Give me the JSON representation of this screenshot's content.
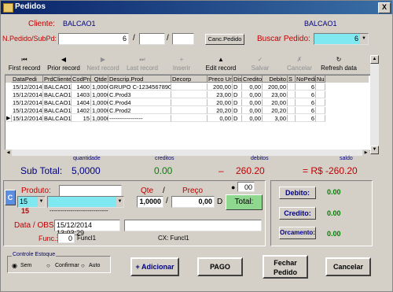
{
  "window": {
    "title": "Pedidos",
    "close_glyph": "X"
  },
  "header": {
    "cliente_label": "Cliente:",
    "cliente_value": "BALCAO1",
    "cliente_right": "BALCAO1",
    "pedido_label": "N.Pedido/SubPd:",
    "pedido_num": "6",
    "slash1": "/",
    "slash2": "/",
    "canc_btn": "Canc.Pedido",
    "buscar_label": "Buscar Pedido:",
    "buscar_value": "6"
  },
  "navbar": [
    {
      "label": "First record",
      "icon": "⏮",
      "disabled": false
    },
    {
      "label": "Prior record",
      "icon": "◀",
      "disabled": false
    },
    {
      "label": "Next record",
      "icon": "▶",
      "disabled": true
    },
    {
      "label": "Last record",
      "icon": "⏭",
      "disabled": true
    },
    {
      "label": "Inserir",
      "icon": "+",
      "disabled": true
    },
    {
      "label": "Edit record",
      "icon": "▲",
      "disabled": false
    },
    {
      "label": "Salvar",
      "icon": "✓",
      "disabled": true
    },
    {
      "label": "Cancelar",
      "icon": "✗",
      "disabled": true
    },
    {
      "label": "Refresh data",
      "icon": "↻",
      "disabled": false
    }
  ],
  "grid": {
    "columns": [
      "DataPedi",
      "PrdCliente",
      "CodProd",
      "Qtde",
      "Descrip.Prod",
      "Decorp",
      "Preco Unit",
      "Dis",
      "Credito",
      "Debito",
      "S",
      "NoPedido",
      "Nu"
    ],
    "rows": [
      [
        "15/12/2014",
        "BALCAO1",
        "1400",
        "1,0000",
        "GRUPO C-1234567890",
        "",
        "200,00",
        "D",
        "0,00",
        "200,00",
        "",
        "6",
        ""
      ],
      [
        "15/12/2014",
        "BALCAO1",
        "1403",
        "1,0000",
        "C.Prod3",
        "",
        "23,00",
        "D",
        "0,00",
        "23,00",
        "",
        "6",
        ""
      ],
      [
        "15/12/2014",
        "BALCAO1",
        "1404",
        "1,0000",
        "C.Prod4",
        "",
        "20,00",
        "D",
        "0,00",
        "20,00",
        "",
        "6",
        ""
      ],
      [
        "15/12/2014",
        "BALCAO1",
        "1402",
        "1,0000",
        "C.Prod2",
        "",
        "20,20",
        "D",
        "0,00",
        "20,20",
        "",
        "6",
        ""
      ],
      [
        "15/12/2014",
        "BALCAO1",
        "15",
        "1,0000",
        "-----------------",
        "",
        "0,00",
        "D",
        "0,00",
        "3,00",
        "",
        "6",
        ""
      ]
    ]
  },
  "totals": {
    "quantidade_label": "quantidade",
    "creditos_label": "creditos",
    "debitos_label": "debitos",
    "saldo_label": "saldo",
    "subtotal_label": "Sub Total:",
    "quantidade": "5,0000",
    "creditos": "0.00",
    "minus": "–",
    "debitos": "260.20",
    "saldo": "= R$ -260.20"
  },
  "produto": {
    "c_btn": "C",
    "produto_label": "Produto:",
    "codigo": "15",
    "codigo_sub": "15",
    "dashes": "----------------------------",
    "qte_label": "Qte",
    "slash": "/",
    "preco_label": "Preço",
    "qte_value": "1,0000",
    "preco_value": "0,00",
    "d_label": "D",
    "pct_value": "00",
    "total_btn": "Total:",
    "data_obs_label": "Data / OBS.",
    "data_obs_value": "15/12/2014 13:03:29",
    "func_label": "Func.:",
    "func_value": "0",
    "func_name": "Funcl1",
    "cx_label": "CX: Funcl1"
  },
  "side": {
    "debito_btn": "Debito:",
    "debito_value": "0.00",
    "credito_btn": "Credito:",
    "credito_value": "0.00",
    "orcamento_btn": "Orcamento:",
    "orcamento_value": "0.00"
  },
  "estoque": {
    "legend": "Controle Estoque",
    "opt1": "Sem",
    "opt2": "Confirmar",
    "opt3": "Auto"
  },
  "buttons": {
    "adicionar": "+ Adicionar",
    "pago": "PAGO",
    "fechar": "Fechar Pedido",
    "cancelar": "Cancelar"
  },
  "colors": {
    "accent_cyan": "#7fe8f0",
    "label_red": "#c00000",
    "total_green": "#8fd88f"
  }
}
